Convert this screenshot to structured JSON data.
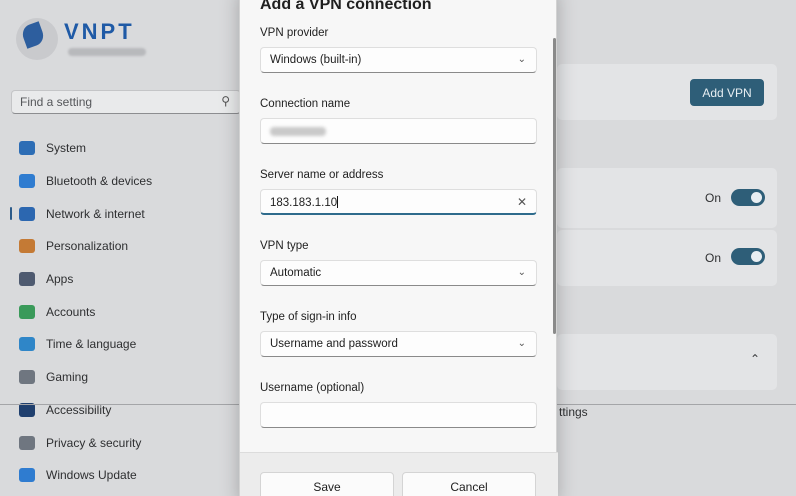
{
  "background": {
    "brand": "VNPT",
    "search_placeholder": "Find a setting",
    "nav": [
      {
        "label": "System",
        "icon": "system-icon",
        "color": "#2d6db5"
      },
      {
        "label": "Bluetooth & devices",
        "icon": "bluetooth-icon",
        "color": "#2f7cd0"
      },
      {
        "label": "Network & internet",
        "icon": "wifi-icon",
        "color": "#2c67b0",
        "active": true
      },
      {
        "label": "Personalization",
        "icon": "brush-icon",
        "color": "#c47a35"
      },
      {
        "label": "Apps",
        "icon": "apps-icon",
        "color": "#4e5a70"
      },
      {
        "label": "Accounts",
        "icon": "person-icon",
        "color": "#3a9a5a"
      },
      {
        "label": "Time & language",
        "icon": "globe-clock-icon",
        "color": "#2f86c8"
      },
      {
        "label": "Gaming",
        "icon": "controller-icon",
        "color": "#6f7680"
      },
      {
        "label": "Accessibility",
        "icon": "accessibility-icon",
        "color": "#1f3f6e"
      },
      {
        "label": "Privacy & security",
        "icon": "shield-icon",
        "color": "#6f7680"
      },
      {
        "label": "Windows Update",
        "icon": "update-icon",
        "color": "#2f7cd0"
      }
    ],
    "add_vpn_label": "Add VPN",
    "toggle1_label": "On",
    "toggle2_label": "On",
    "settings_fragment": "ttings"
  },
  "dialog": {
    "title": "Add a VPN connection",
    "vpn_provider_label": "VPN provider",
    "vpn_provider_value": "Windows (built-in)",
    "connection_name_label": "Connection name",
    "server_label": "Server name or address",
    "server_value": "183.183.1.10",
    "vpn_type_label": "VPN type",
    "vpn_type_value": "Automatic",
    "signin_label": "Type of sign-in info",
    "signin_value": "Username and password",
    "username_label": "Username (optional)",
    "save_label": "Save",
    "cancel_label": "Cancel"
  },
  "colors": {
    "accent": "#2e5e78"
  }
}
